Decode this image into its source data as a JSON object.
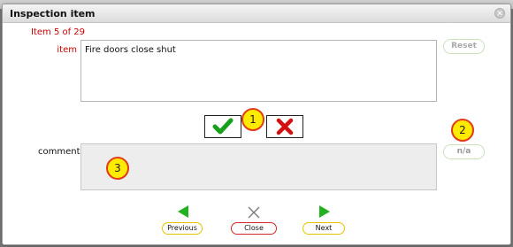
{
  "dialog": {
    "title": "Inspection item",
    "counter": "Item 5 of 29"
  },
  "item": {
    "label": "item",
    "value": "Fire doors close shut"
  },
  "buttons": {
    "reset": "Reset",
    "na": "n/a",
    "previous": "Previous",
    "close": "Close",
    "next": "Next"
  },
  "comment": {
    "label": "comment",
    "value": ""
  },
  "markers": [
    "1",
    "2",
    "3"
  ],
  "colors": {
    "accent_red": "#cc0000",
    "check_green": "#17a01a",
    "cross_red": "#d40f0f",
    "marker_fill": "#ffeb00",
    "marker_border": "#e03b1a",
    "nav_green": "#22b11f"
  },
  "icons": {
    "close": "close-circle-icon",
    "check": "checkmark-icon",
    "cross": "cross-icon",
    "prev": "triangle-left-icon",
    "next": "triangle-right-icon",
    "close_nav": "x-icon"
  }
}
